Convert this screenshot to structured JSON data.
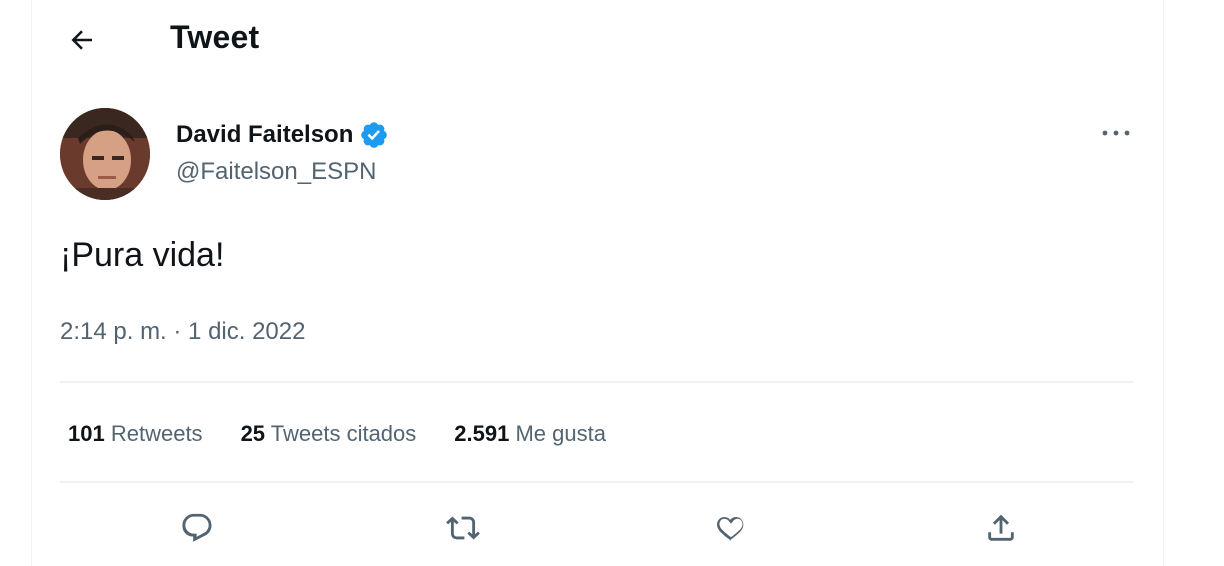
{
  "header": {
    "title": "Tweet",
    "back_icon": "arrow-left-icon"
  },
  "tweet": {
    "author": {
      "name": "David Faitelson",
      "handle": "@Faitelson_ESPN",
      "verified": true
    },
    "text": "¡Pura vida!",
    "timestamp": "2:14 p. m. · 1 dic. 2022"
  },
  "stats": {
    "retweets_count": "101",
    "retweets_label": "Retweets",
    "quotes_count": "25",
    "quotes_label": "Tweets citados",
    "likes_count": "2.591",
    "likes_label": "Me gusta"
  },
  "actions": [
    "reply-icon",
    "retweet-icon",
    "like-icon",
    "share-icon"
  ],
  "colors": {
    "text": "#0f1419",
    "secondary": "#536471",
    "verified": "#1d9bf0",
    "divider": "#eff3f4"
  }
}
